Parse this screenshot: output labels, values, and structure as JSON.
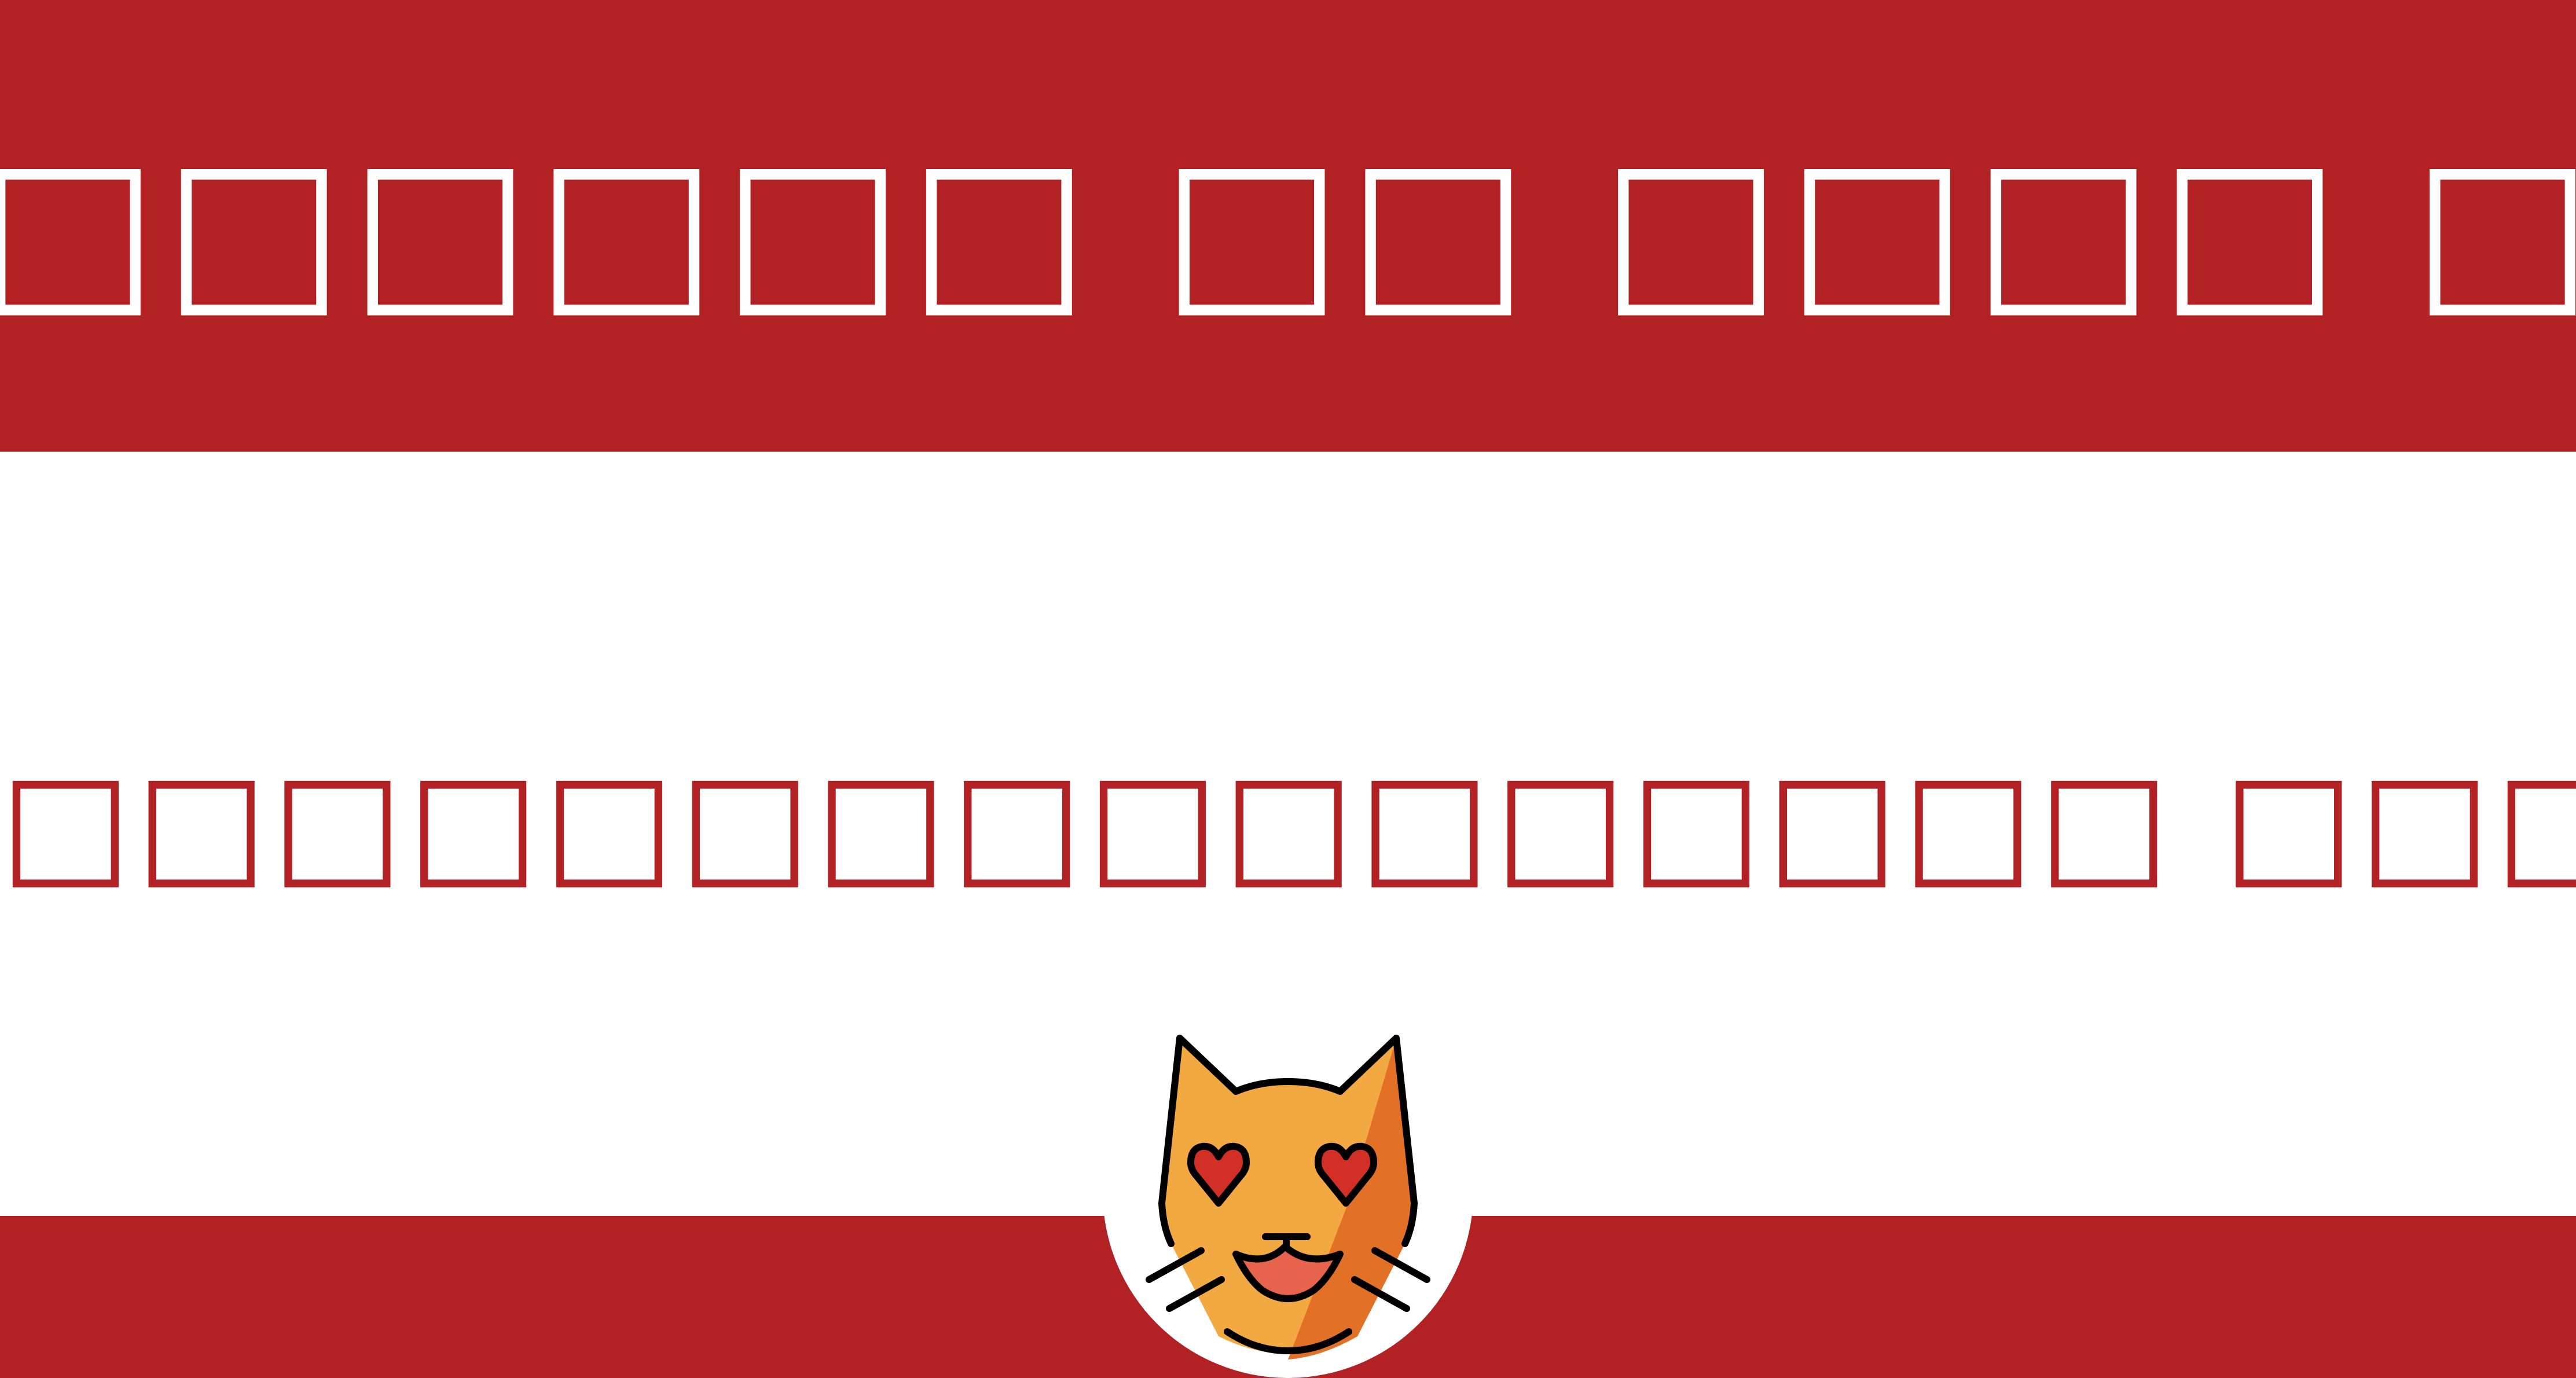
{
  "header": {
    "title": "□□□□□□□ □□ □□□□ □□"
  },
  "main": {
    "subtitle": "□□□□□□□□□□□□□□□□ □□□□□"
  },
  "logo": {
    "icon": "smiling-cat-heart-eyes-icon"
  },
  "colors": {
    "brand_red": "#B22224",
    "background": "#FFFFFF",
    "cat_orange": "#F2A942",
    "cat_shadow": "#E37027",
    "heart_red": "#D22F27",
    "mouth_red": "#E8634E"
  }
}
